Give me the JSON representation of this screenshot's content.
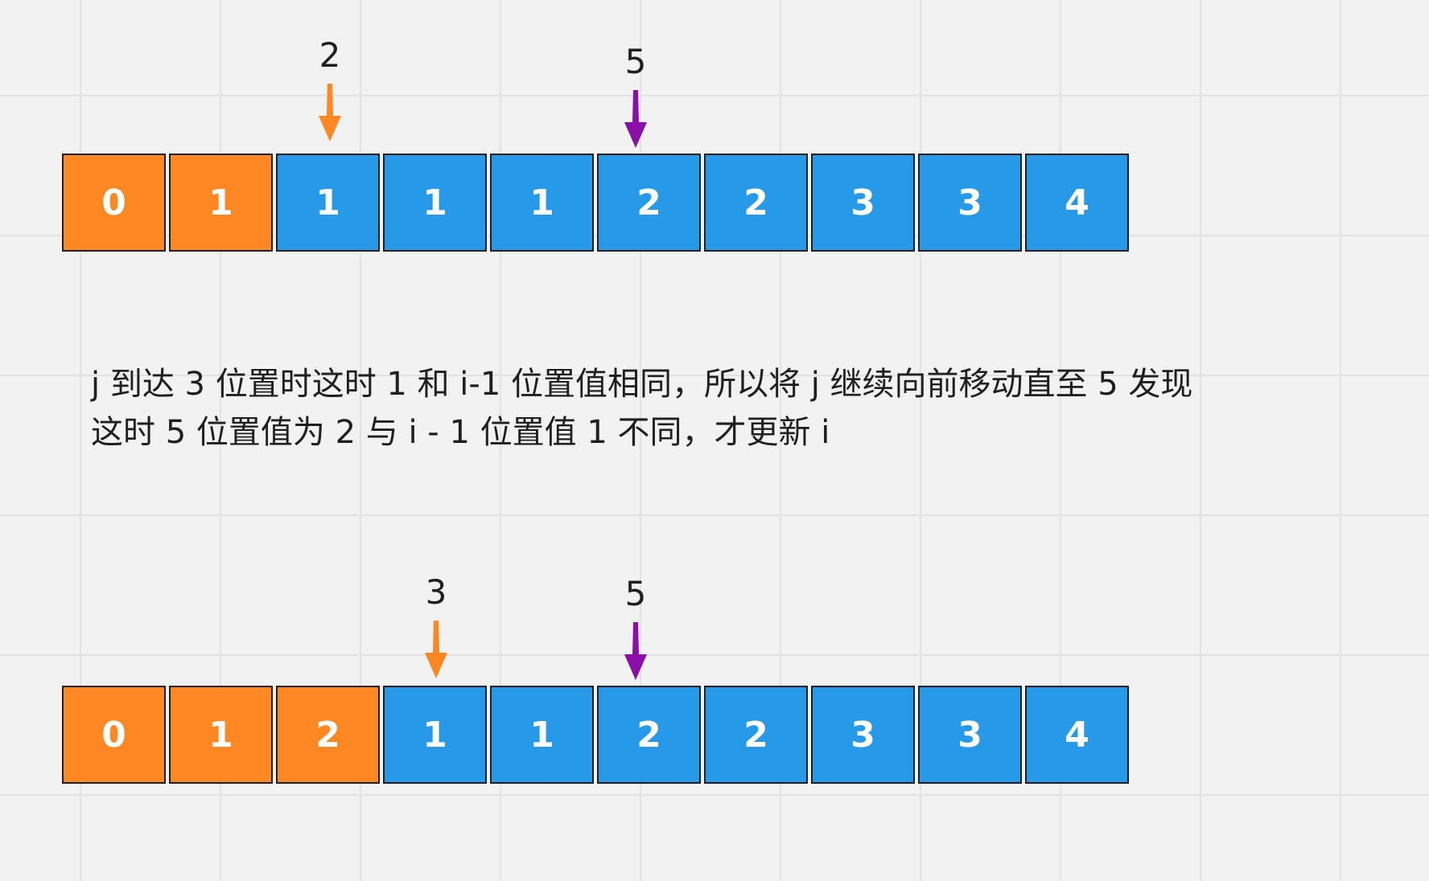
{
  "colors": {
    "orange": "#fd8720",
    "blue": "#2699e9",
    "purple": "#8a0fa8",
    "border": "#1f1f1f"
  },
  "top": {
    "cells": [
      {
        "value": "0",
        "color": "orange"
      },
      {
        "value": "1",
        "color": "orange"
      },
      {
        "value": "1",
        "color": "blue"
      },
      {
        "value": "1",
        "color": "blue"
      },
      {
        "value": "1",
        "color": "blue"
      },
      {
        "value": "2",
        "color": "blue"
      },
      {
        "value": "2",
        "color": "blue"
      },
      {
        "value": "3",
        "color": "blue"
      },
      {
        "value": "3",
        "color": "blue"
      },
      {
        "value": "4",
        "color": "blue"
      }
    ],
    "pointer_i": {
      "label": "2",
      "color": "orange"
    },
    "pointer_j": {
      "label": "5",
      "color": "purple"
    }
  },
  "explanation": {
    "line1": "j 到达 3 位置时这时 1 和 i-1 位置值相同，所以将 j 继续向前移动直至 5 发现",
    "line2": "这时 5 位置值为 2 与 i - 1 位置值 1 不同，才更新 i"
  },
  "bottom": {
    "cells": [
      {
        "value": "0",
        "color": "orange"
      },
      {
        "value": "1",
        "color": "orange"
      },
      {
        "value": "2",
        "color": "orange"
      },
      {
        "value": "1",
        "color": "blue"
      },
      {
        "value": "1",
        "color": "blue"
      },
      {
        "value": "2",
        "color": "blue"
      },
      {
        "value": "2",
        "color": "blue"
      },
      {
        "value": "3",
        "color": "blue"
      },
      {
        "value": "3",
        "color": "blue"
      },
      {
        "value": "4",
        "color": "blue"
      }
    ],
    "pointer_i": {
      "label": "3",
      "color": "orange"
    },
    "pointer_j": {
      "label": "5",
      "color": "purple"
    }
  }
}
